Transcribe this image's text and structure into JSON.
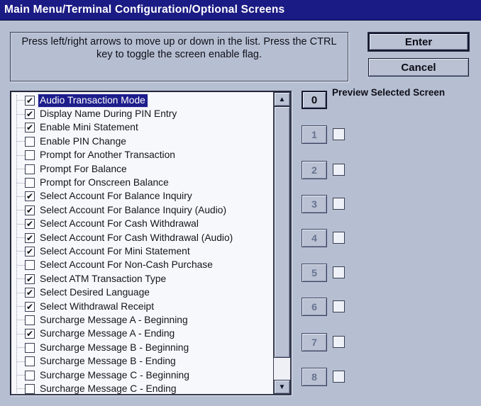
{
  "window": {
    "title": "Main Menu/Terminal Configuration/Optional Screens"
  },
  "instructions": {
    "text": "Press left/right arrows to move up or down in the list.  Press the CTRL key to toggle the screen enable flag."
  },
  "buttons": {
    "enter": "Enter",
    "cancel": "Cancel"
  },
  "preview": {
    "label": "Preview Selected Screen",
    "keys": [
      {
        "label": "0",
        "enabled": true,
        "checkbox": false,
        "checked": false
      },
      {
        "label": "1",
        "enabled": false,
        "checkbox": true,
        "checked": false
      },
      {
        "label": "2",
        "enabled": false,
        "checkbox": true,
        "checked": false
      },
      {
        "label": "3",
        "enabled": false,
        "checkbox": true,
        "checked": false
      },
      {
        "label": "4",
        "enabled": false,
        "checkbox": true,
        "checked": false
      },
      {
        "label": "5",
        "enabled": false,
        "checkbox": true,
        "checked": false
      },
      {
        "label": "6",
        "enabled": false,
        "checkbox": true,
        "checked": false
      },
      {
        "label": "7",
        "enabled": false,
        "checkbox": true,
        "checked": false
      },
      {
        "label": "8",
        "enabled": false,
        "checkbox": true,
        "checked": false
      }
    ]
  },
  "screen_list": {
    "items": [
      {
        "label": "Audio Transaction Mode",
        "checked": true,
        "selected": true
      },
      {
        "label": "Display Name During PIN Entry",
        "checked": true,
        "selected": false
      },
      {
        "label": "Enable Mini Statement",
        "checked": true,
        "selected": false
      },
      {
        "label": "Enable PIN Change",
        "checked": false,
        "selected": false
      },
      {
        "label": "Prompt for Another Transaction",
        "checked": false,
        "selected": false
      },
      {
        "label": "Prompt For Balance",
        "checked": false,
        "selected": false
      },
      {
        "label": "Prompt for Onscreen Balance",
        "checked": false,
        "selected": false
      },
      {
        "label": "Select Account For Balance Inquiry",
        "checked": true,
        "selected": false
      },
      {
        "label": "Select Account For Balance Inquiry (Audio)",
        "checked": true,
        "selected": false
      },
      {
        "label": "Select Account For Cash Withdrawal",
        "checked": true,
        "selected": false
      },
      {
        "label": "Select Account For Cash Withdrawal (Audio)",
        "checked": true,
        "selected": false
      },
      {
        "label": "Select Account For Mini Statement",
        "checked": true,
        "selected": false
      },
      {
        "label": "Select Account For Non-Cash Purchase",
        "checked": false,
        "selected": false
      },
      {
        "label": "Select ATM Transaction Type",
        "checked": true,
        "selected": false
      },
      {
        "label": "Select Desired Language",
        "checked": true,
        "selected": false
      },
      {
        "label": "Select Withdrawal Receipt",
        "checked": true,
        "selected": false
      },
      {
        "label": "Surcharge Message A - Beginning",
        "checked": false,
        "selected": false
      },
      {
        "label": "Surcharge Message A - Ending",
        "checked": true,
        "selected": false
      },
      {
        "label": "Surcharge Message B - Beginning",
        "checked": false,
        "selected": false
      },
      {
        "label": "Surcharge Message B - Ending",
        "checked": false,
        "selected": false
      },
      {
        "label": "Surcharge Message C - Beginning",
        "checked": false,
        "selected": false
      },
      {
        "label": "Surcharge Message C - Ending",
        "checked": false,
        "selected": false
      }
    ]
  },
  "icons": {
    "checkmark": "✔",
    "scroll_up": "▲",
    "scroll_down": "▼"
  },
  "colors": {
    "titlebar_bg": "#1b1b85",
    "dialog_bg": "#b6bfd2",
    "selection_bg": "#1d1d8c",
    "list_bg": "#f7f8fc",
    "disabled_key_text": "#66738f"
  }
}
